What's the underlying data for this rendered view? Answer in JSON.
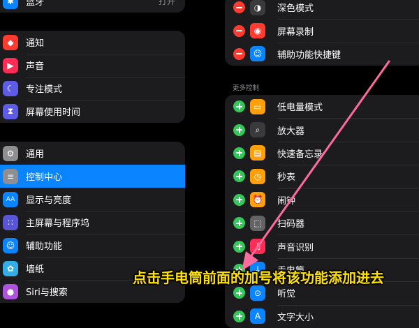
{
  "sidebar": {
    "top_row": {
      "label": "蓝牙",
      "value": "打开",
      "icon": "bluetooth-icon",
      "color": "#0a84ff"
    },
    "group1": [
      {
        "label": "通知",
        "icon": "notification-bell-icon",
        "color": "#ff3b30",
        "glyph": "◆"
      },
      {
        "label": "声音",
        "icon": "speaker-icon",
        "color": "#ff2d55",
        "glyph": "▶"
      },
      {
        "label": "专注模式",
        "icon": "moon-icon",
        "color": "#5e5ce6",
        "glyph": "☾"
      },
      {
        "label": "屏幕使用时间",
        "icon": "hourglass-icon",
        "color": "#5e5ce6",
        "glyph": "⧗"
      }
    ],
    "group2": [
      {
        "label": "通用",
        "icon": "gear-icon",
        "color": "#8e8e93",
        "glyph": "⚙"
      },
      {
        "label": "控制中心",
        "icon": "toggles-icon",
        "color": "#8e8e93",
        "glyph": "≡",
        "selected": true
      },
      {
        "label": "显示与亮度",
        "icon": "text-size-icon",
        "color": "#0a84ff",
        "glyph": "AA"
      },
      {
        "label": "主屏幕与程序坞",
        "icon": "home-grid-icon",
        "color": "#5856d6",
        "glyph": "∷"
      },
      {
        "label": "辅助功能",
        "icon": "accessibility-icon",
        "color": "#0a84ff",
        "glyph": "☺"
      },
      {
        "label": "墙纸",
        "icon": "wallpaper-flower-icon",
        "color": "#32ade6",
        "glyph": "✿"
      },
      {
        "label": "Siri与搜索",
        "icon": "siri-icon",
        "color": "#af52de",
        "glyph": "●"
      }
    ]
  },
  "included": [
    {
      "label": "深色模式",
      "icon": "dark-mode-icon",
      "color": "#3a3a3c",
      "glyph": "◑"
    },
    {
      "label": "屏幕录制",
      "icon": "screen-record-icon",
      "color": "#ff3b30",
      "glyph": "◉"
    },
    {
      "label": "辅助功能快捷键",
      "icon": "accessibility-shortcut-icon",
      "color": "#0a84ff",
      "glyph": "☺"
    }
  ],
  "more_header": "更多控制",
  "more": [
    {
      "label": "低电量模式",
      "icon": "low-battery-icon",
      "color": "#ff9f0a",
      "glyph": "▭"
    },
    {
      "label": "放大器",
      "icon": "magnifier-icon",
      "color": "#3a3a3c",
      "glyph": "⌕"
    },
    {
      "label": "快速备忘录",
      "icon": "quick-note-icon",
      "color": "#ff9f0a",
      "glyph": "▤"
    },
    {
      "label": "秒表",
      "icon": "stopwatch-icon",
      "color": "#ff9f0a",
      "glyph": "◷"
    },
    {
      "label": "闹钟",
      "icon": "alarm-clock-icon",
      "color": "#ff9f0a",
      "glyph": "⏰"
    },
    {
      "label": "扫码器",
      "icon": "qr-scanner-icon",
      "color": "#636366",
      "glyph": "⬚"
    },
    {
      "label": "声音识别",
      "icon": "sound-recognition-icon",
      "color": "#ff2d55",
      "glyph": "♫"
    },
    {
      "label": "手电筒",
      "icon": "flashlight-icon",
      "color": "#0a84ff",
      "glyph": "↓"
    },
    {
      "label": "听觉",
      "icon": "ear-icon",
      "color": "#0a84ff",
      "glyph": "⊙"
    },
    {
      "label": "文字大小",
      "icon": "text-size-control-icon",
      "color": "#0a84ff",
      "glyph": "A"
    }
  ],
  "caption": "点击手电筒前面的加号将该功能添加进去",
  "colors": {
    "selected": "#0a84ff",
    "arrow": "#ff6b9d",
    "caption": "#ffe100"
  }
}
